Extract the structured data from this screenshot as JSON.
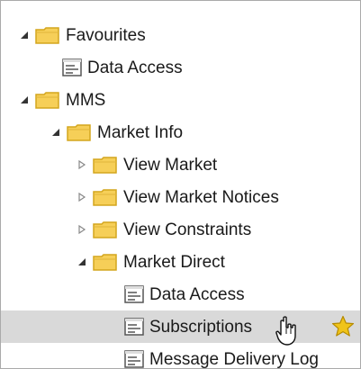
{
  "tree": {
    "favourites_label": "Favourites",
    "favourites_data_access_label": "Data Access",
    "mms_label": "MMS",
    "market_info_label": "Market Info",
    "view_market_label": "View Market",
    "view_market_notices_label": "View Market Notices",
    "view_constraints_label": "View Constraints",
    "market_direct_label": "Market Direct",
    "market_direct_data_access_label": "Data Access",
    "subscriptions_label": "Subscriptions",
    "message_delivery_log_label": "Message Delivery Log"
  },
  "icons": {
    "folder": "folder-icon",
    "page": "page-icon",
    "star": "star-icon",
    "cursor": "hand-cursor-icon",
    "expanded_toggle": "triangle-down-icon",
    "collapsed_toggle": "triangle-right-icon"
  },
  "colors": {
    "folder_fill": "#f6cf58",
    "folder_stroke": "#d4a51d",
    "page_fill": "#ffffff",
    "page_stroke": "#555555",
    "selection_bg": "#d9d9d9",
    "star_fill": "#f0c419",
    "star_stroke": "#b58a00"
  }
}
